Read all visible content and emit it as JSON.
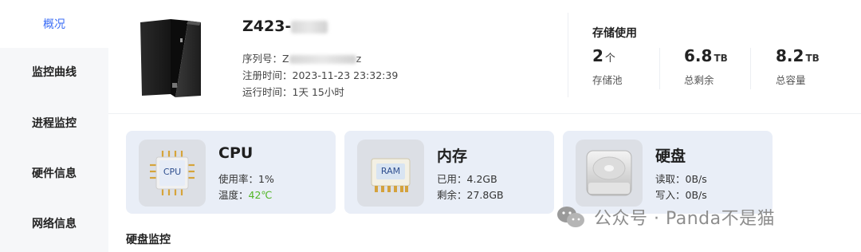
{
  "sidebar": {
    "items": [
      {
        "label": "概况",
        "active": true
      },
      {
        "label": "监控曲线",
        "active": false
      },
      {
        "label": "进程监控",
        "active": false
      },
      {
        "label": "硬件信息",
        "active": false
      },
      {
        "label": "网络信息",
        "active": false
      }
    ]
  },
  "device": {
    "name_prefix": "Z423-",
    "serial_label": "序列号：",
    "serial_prefix": "Z",
    "serial_suffix": "z",
    "register_label": "注册时间：",
    "register_value": "2023-11-23 23:32:39",
    "uptime_label": "运行时间：",
    "uptime_value": "1天 15小时"
  },
  "storage": {
    "title": "存储使用",
    "stats": [
      {
        "value": "2",
        "unit": "个",
        "label": "存储池"
      },
      {
        "value": "6.8",
        "unit": "TB",
        "label": "总剩余"
      },
      {
        "value": "8.2",
        "unit": "TB",
        "label": "总容量"
      }
    ]
  },
  "cards": {
    "cpu": {
      "title": "CPU",
      "chip_text": "CPU",
      "usage_label": "使用率：",
      "usage_value": "1%",
      "temp_label": "温度：",
      "temp_value": "42℃"
    },
    "memory": {
      "title": "内存",
      "chip_text": "RAM",
      "used_label": "已用：",
      "used_value": "4.2GB",
      "free_label": "剩余：",
      "free_value": "27.8GB"
    },
    "disk": {
      "title": "硬盘",
      "read_label": "读取：",
      "read_value": "0B/s",
      "write_label": "写入：",
      "write_value": "0B/s"
    }
  },
  "section": {
    "title": "硬盘监控"
  },
  "watermark": {
    "text": "公众号 · Panda不是猫"
  },
  "colors": {
    "accent": "#3b6df6",
    "temp_ok": "#52b626",
    "card_bg": "#e9eef7"
  }
}
